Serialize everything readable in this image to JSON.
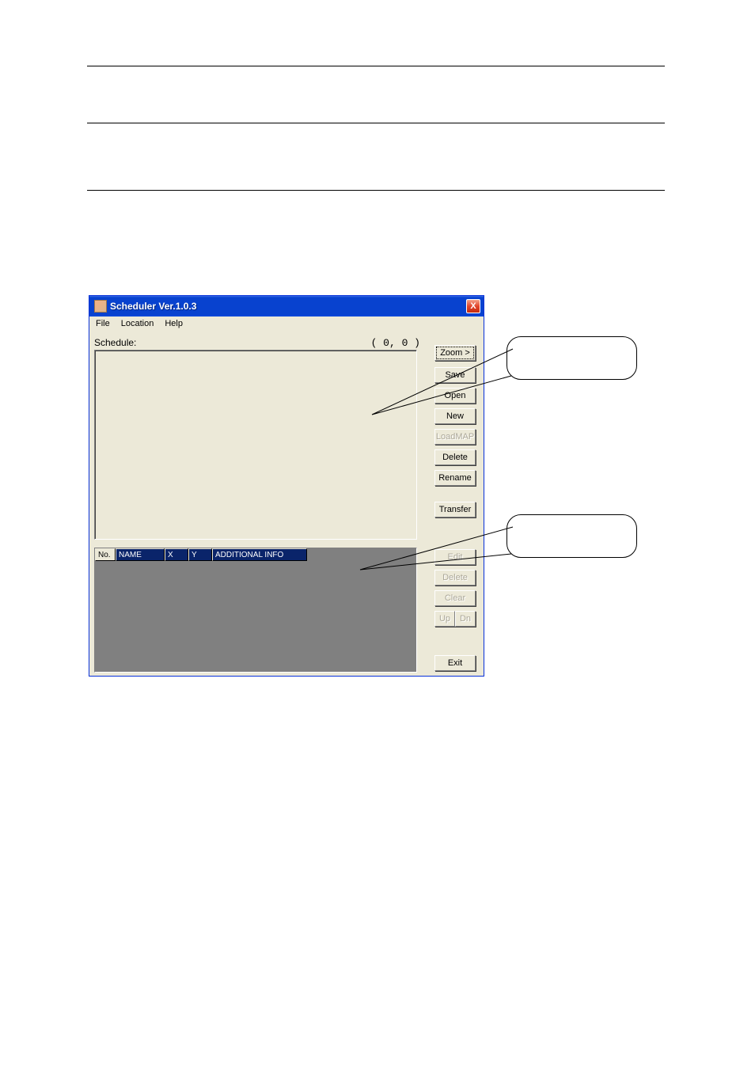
{
  "window": {
    "title": "Scheduler Ver.1.0.3",
    "close_icon": "X"
  },
  "menubar": {
    "file": "File",
    "location": "Location",
    "help": "Help"
  },
  "labels": {
    "schedule": "Schedule:",
    "coords": "(   0,  0 )"
  },
  "table": {
    "headers": {
      "no": "No.",
      "name": "NAME",
      "x": "X",
      "y": "Y",
      "info": "ADDITIONAL INFO"
    }
  },
  "buttons": {
    "zoom": "Zoom >",
    "save": "Save",
    "open": "Open",
    "new": "New",
    "loadmap": "LoadMAP",
    "delete_top": "Delete",
    "rename": "Rename",
    "transfer": "Transfer",
    "edit": "Edit",
    "delete_bottom": "Delete",
    "clear": "Clear",
    "up": "Up",
    "dn": "Dn",
    "exit": "Exit"
  }
}
